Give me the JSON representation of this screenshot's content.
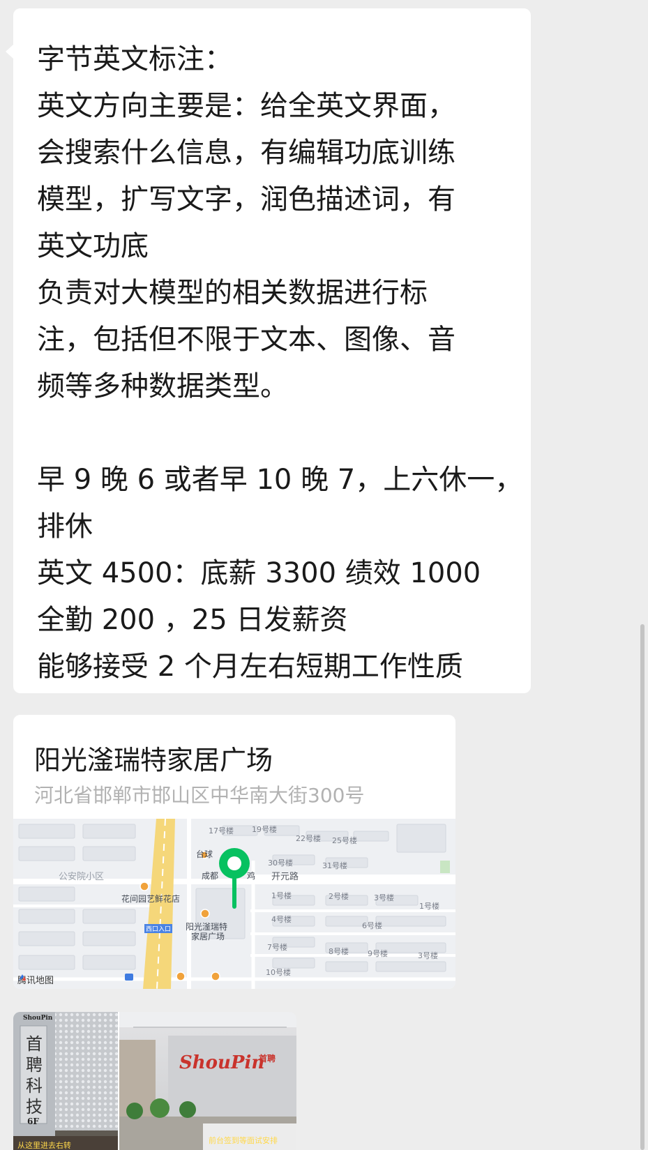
{
  "chat": {
    "message_text": {
      "lines": [
        "字节英文标注：",
        "英文方向主要是：给全英文界面，",
        "会搜索什么信息，有编辑功底训练",
        "模型，扩写文字，润色描述词，有",
        "英文功底",
        "负责对大模型的相关数据进行标",
        "注，包括但不限于文本、图像、音",
        "频等多种数据类型。",
        "",
        "早 9 晚 6 或者早 10 晚 7，上六休一，",
        "排休",
        "英文 4500：底薪 3300 绩效 1000",
        "全勤 200 ，25 日发薪资",
        "能够接受 2 个月左右短期工作性质"
      ]
    },
    "location_card": {
      "name": "阳光滏瑞特家居广场",
      "address": "河北省邯郸市邯山区中华南大街300号",
      "map": {
        "brand": "腾讯地图",
        "labels": {
          "b17": "17号楼",
          "b19": "19号楼",
          "b22": "22号楼",
          "b25": "25号楼",
          "taiqiu": "台球",
          "b30": "30号楼",
          "b31": "31号楼",
          "chengdu": "成都",
          "ji": "鸡",
          "kaiyuan": "开元路",
          "gonganyuan": "公安院小区",
          "huajian": "花间园艺鲜花店",
          "b1": "1号楼",
          "b2": "2号楼",
          "b3": "3号楼",
          "b1r": "1号楼",
          "b4": "4号楼",
          "b6": "6号楼",
          "entrance": "西口入口",
          "poi1": "阳光滏瑞特",
          "poi2": "家居广场",
          "b7": "7号楼",
          "b8": "8号楼",
          "b9": "9号楼",
          "b3r": "3号楼",
          "b10": "10号楼"
        }
      }
    },
    "photo_message": {
      "photo_a": {
        "sign_brand": "ShouPin",
        "sign_chars": [
          "首",
          "聘",
          "科",
          "技"
        ],
        "floor": "6F",
        "caption": "从这里进去右转"
      },
      "photo_b": {
        "logo": "ShouPin",
        "logo_cn": "首聘",
        "caption": "前台签到等面试安排"
      }
    }
  },
  "colors": {
    "background": "#ededed",
    "bubble": "#ffffff",
    "text": "#1a1a1a",
    "address": "#b2b2b2",
    "pin": "#07c160"
  }
}
